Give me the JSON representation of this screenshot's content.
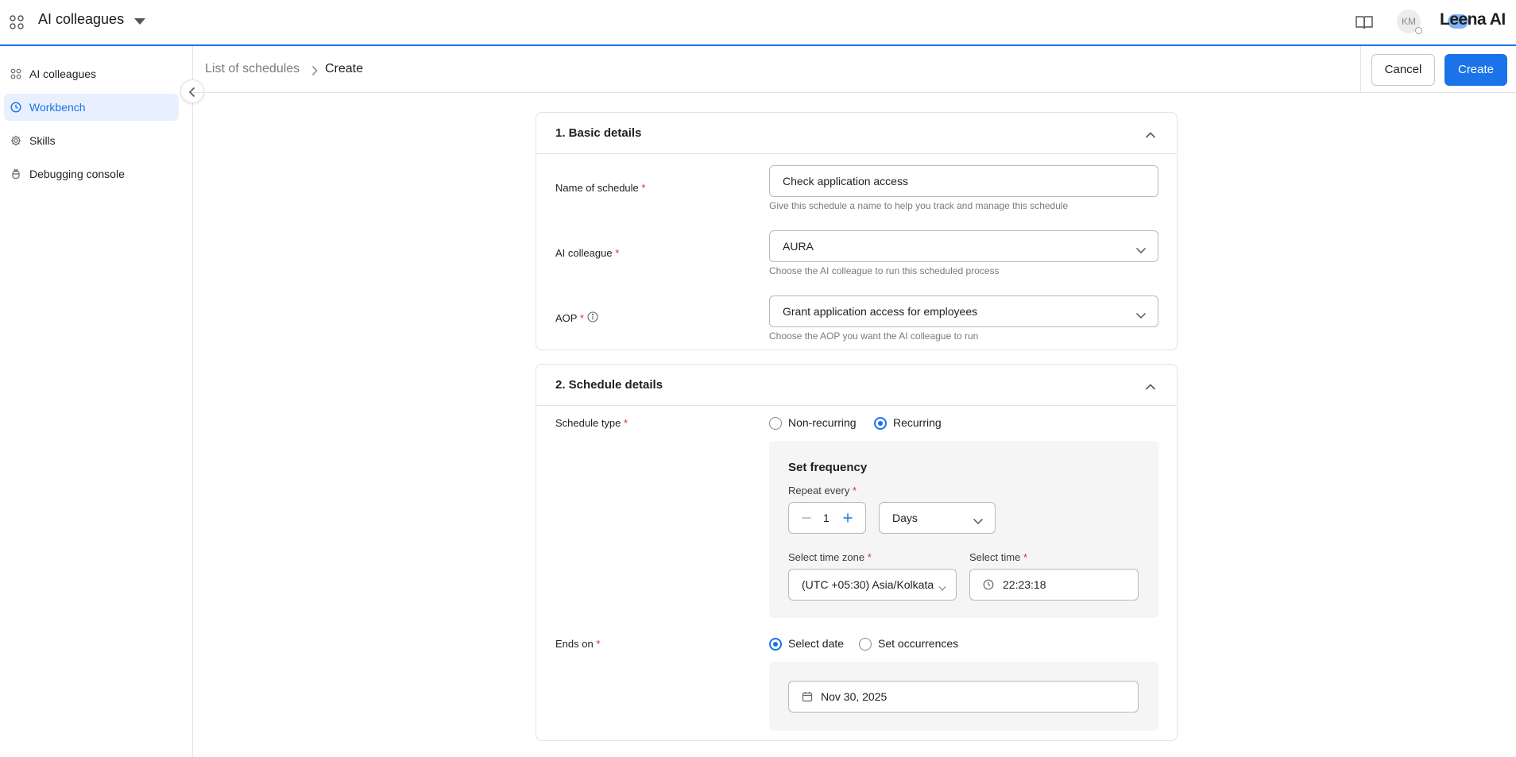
{
  "topbar": {
    "app_title": "AI colleagues",
    "avatar_initials": "KM",
    "brand": "Leena AI",
    "icons": [
      "apps-grid-icon",
      "dropdown-caret-icon",
      "book-icon"
    ]
  },
  "sidebar": {
    "items": [
      {
        "label": "AI colleagues",
        "icon": "apps-grid-icon",
        "active": false
      },
      {
        "label": "Workbench",
        "icon": "clock-icon",
        "active": true
      },
      {
        "label": "Skills",
        "icon": "gear-icon",
        "active": false
      },
      {
        "label": "Debugging console",
        "icon": "bug-icon",
        "active": false
      }
    ]
  },
  "breadcrumb": {
    "parent": "List of schedules",
    "current": "Create"
  },
  "actions": {
    "cancel_label": "Cancel",
    "create_label": "Create"
  },
  "basic_details": {
    "title": "1. Basic details",
    "name": {
      "label": "Name of schedule",
      "required": "*",
      "value": "Check application access",
      "hint": "Give this schedule a name to help you track and manage this schedule"
    },
    "colleague": {
      "label": "AI colleague",
      "required": "*",
      "value": "AURA",
      "hint": "Choose the AI colleague to run this scheduled process"
    },
    "aop": {
      "label": "AOP",
      "required": "*",
      "value": "Grant application access for employees",
      "hint": "Choose the AOP you want the AI colleague to run"
    }
  },
  "schedule_details": {
    "title": "2. Schedule details",
    "schedule_type": {
      "label": "Schedule type",
      "required": "*",
      "options": [
        "Non-recurring",
        "Recurring"
      ],
      "selected": "Recurring"
    },
    "frequency": {
      "title": "Set frequency",
      "repeat_label": "Repeat every",
      "repeat_required": "*",
      "repeat_value": "1",
      "unit": "Days",
      "timezone_label": "Select time zone",
      "timezone_required": "*",
      "timezone_value": "(UTC +05:30) Asia/Kolkata",
      "time_label": "Select time",
      "time_required": "*",
      "time_value": "22:23:18"
    },
    "ends_on": {
      "label": "Ends on",
      "required": "*",
      "options": [
        "Select date",
        "Set occurrences"
      ],
      "selected": "Select date",
      "date_value": "Nov 30, 2025"
    }
  },
  "colors": {
    "accent": "#1a73e8",
    "required": "#d93025",
    "active_bg": "#e8f0fe",
    "panel_bg": "#f5f5f5"
  }
}
